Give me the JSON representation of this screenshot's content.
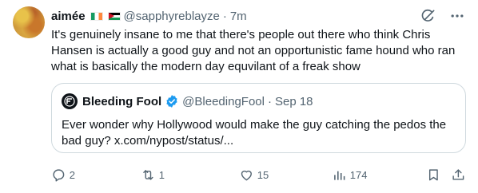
{
  "author": {
    "display_name": "aimée",
    "handle": "@sapphyreblayze",
    "separator": "·",
    "time": "7m",
    "flags": [
      "ireland-flag",
      "palestine-flag"
    ]
  },
  "tweet": {
    "text": "It's genuinely insane to me that there's people out there who think Chris Hansen is actually a good guy and not an opportunistic fame hound who ran what is basically the modern day equvilant of a freak show"
  },
  "quote": {
    "display_name": "Bleeding Fool",
    "verified": true,
    "handle": "@BleedingFool",
    "separator": "·",
    "date": "Sep 18",
    "text": "Ever wonder why Hollywood would make the guy catching the pedos the bad guy? x.com/nypost/status/..."
  },
  "actions": {
    "replies": "2",
    "reposts": "1",
    "likes": "15",
    "views": "174"
  },
  "colors": {
    "text": "#0f1419",
    "secondary": "#536471",
    "border": "#cfd9de",
    "verified": "#1d9bf0"
  }
}
